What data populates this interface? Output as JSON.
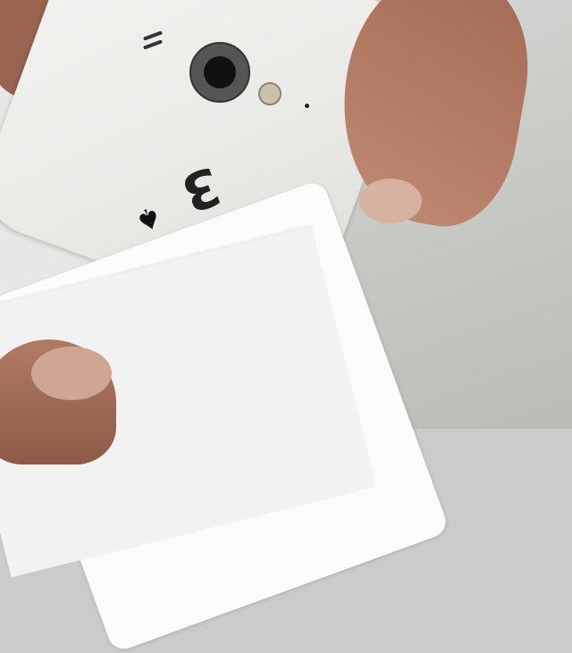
{
  "scene": {
    "card": {
      "rank": "3",
      "suit": "♠"
    },
    "colors": {
      "card": "#fbfbfb",
      "phone": "#ececea",
      "table": "#c9ccc8",
      "skin": "#a56a55"
    }
  }
}
